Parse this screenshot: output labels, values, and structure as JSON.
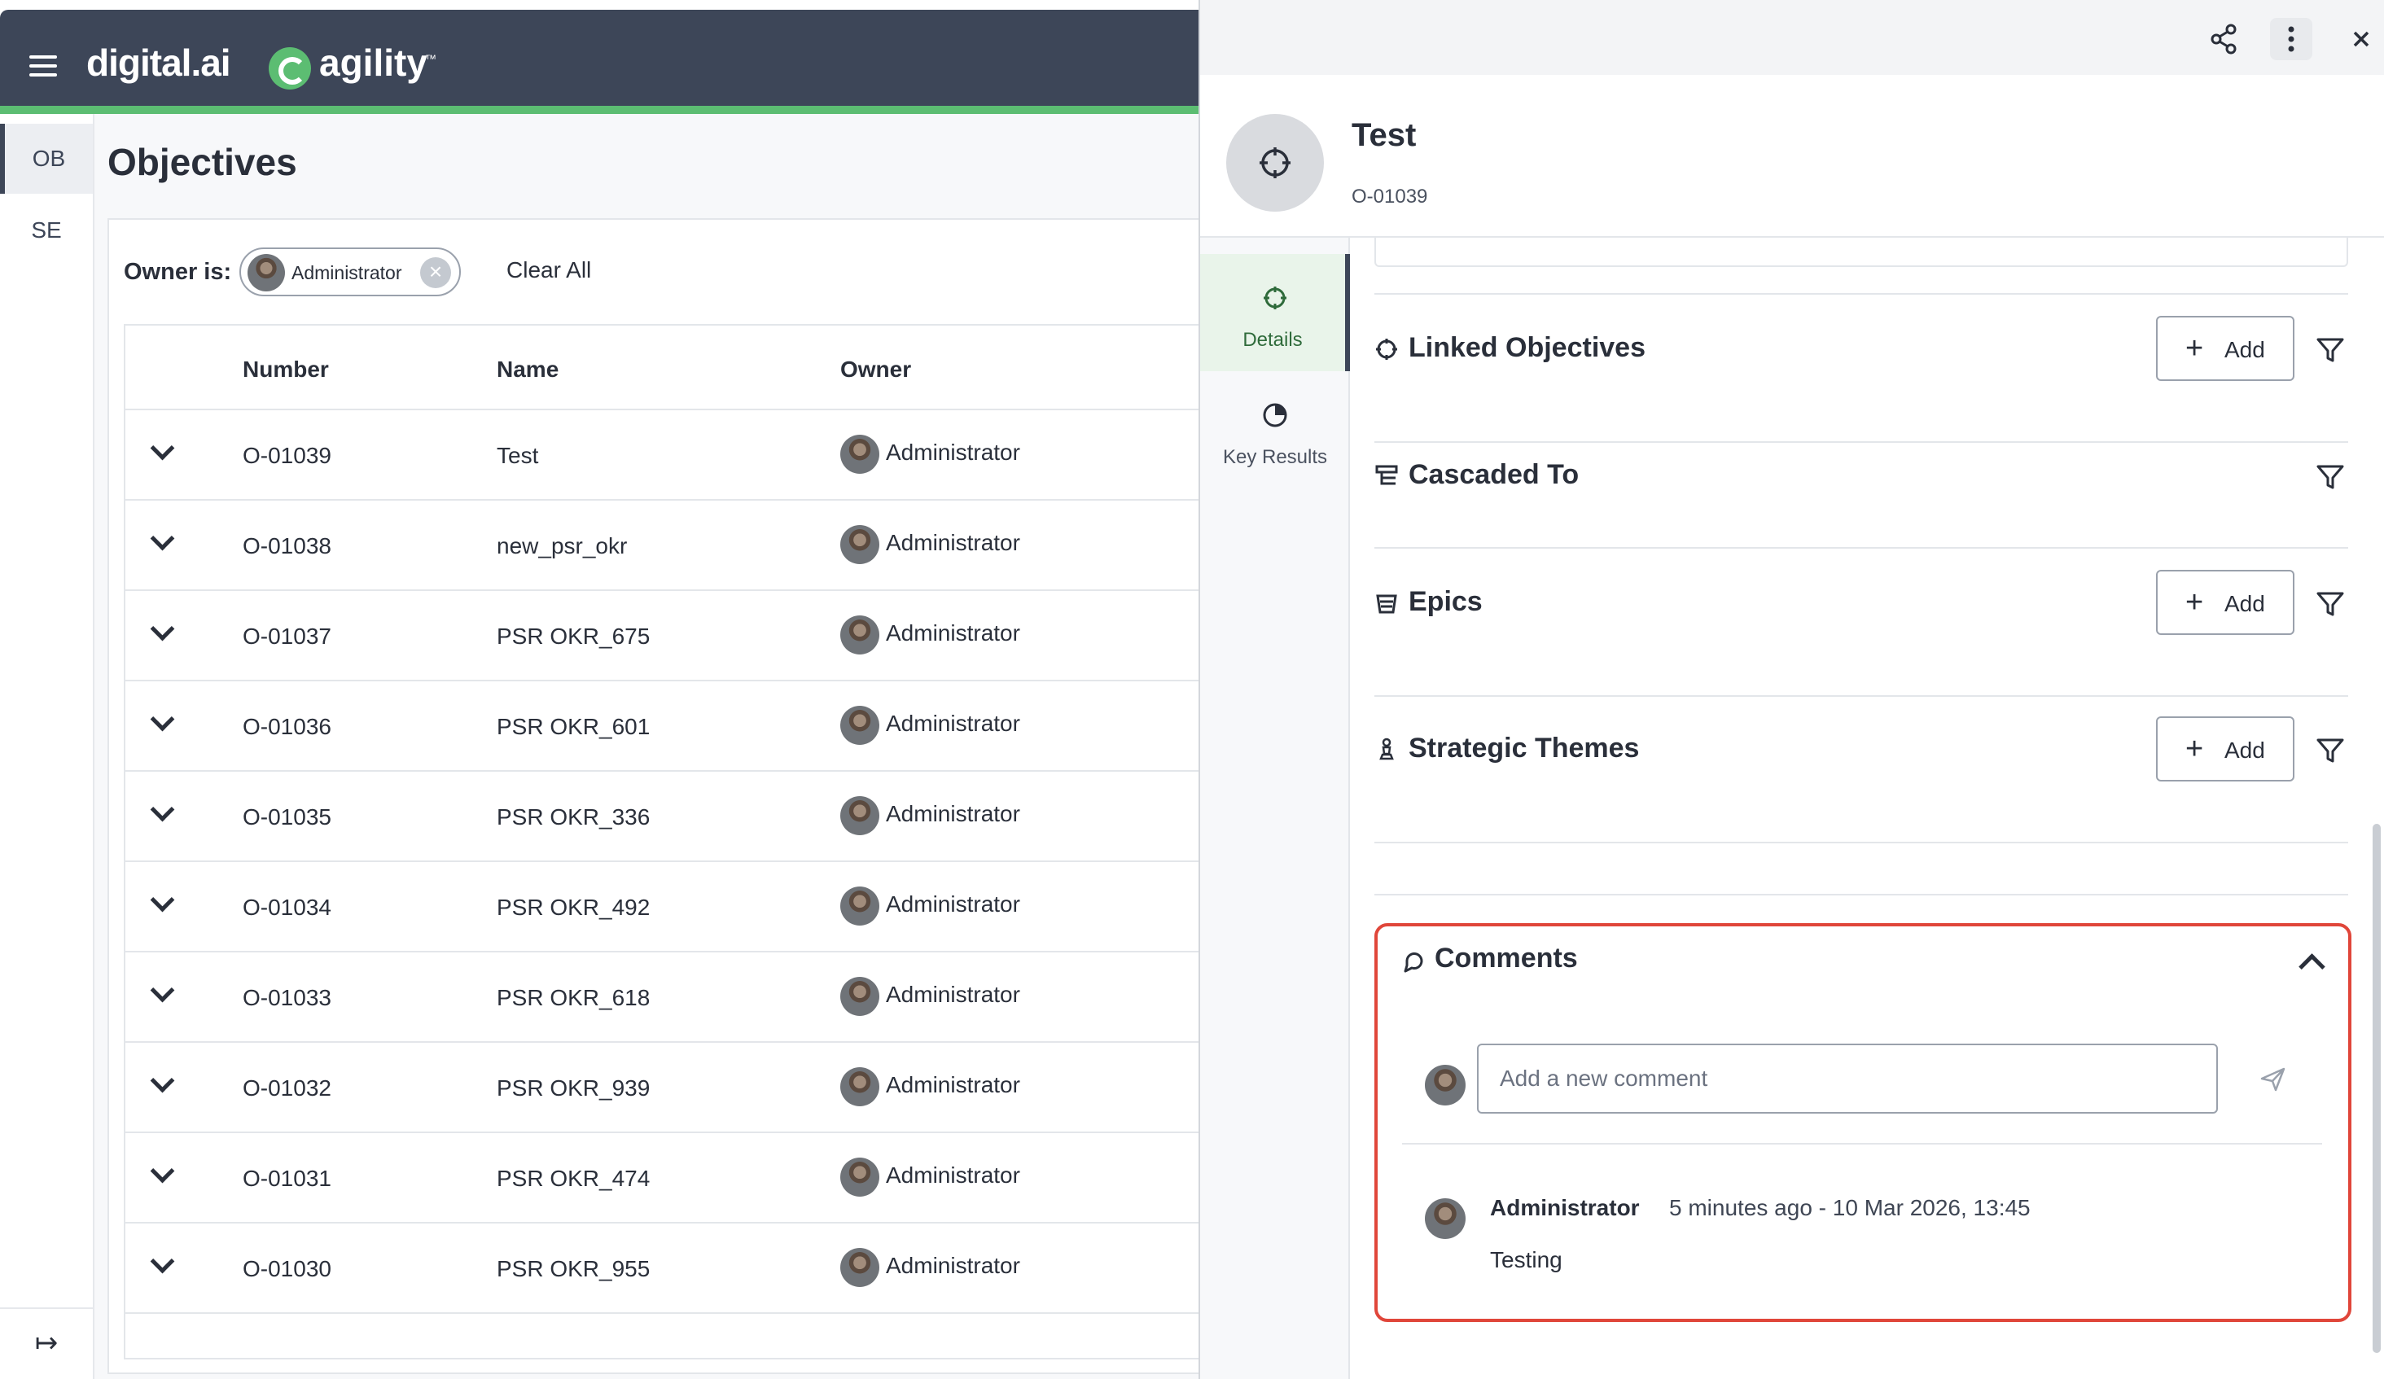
{
  "app": {
    "brand_left": "digital.ai",
    "brand_right": "agility",
    "brand_tm": "™",
    "accent": "#5cbd72",
    "header_bg": "#3d4658"
  },
  "rail": {
    "items": [
      {
        "label": "OB",
        "active": true
      },
      {
        "label": "SE",
        "active": false
      }
    ],
    "collapse_icon": "expand-panel-icon",
    "collapse_glyph": "↦"
  },
  "main": {
    "title": "Objectives",
    "filter": {
      "label": "Owner is:",
      "chip_value": "Administrator",
      "chip_remove": "×",
      "clear_all": "Clear All"
    },
    "table": {
      "columns": [
        "Number",
        "Name",
        "Owner"
      ],
      "rows": [
        {
          "number": "O-01039",
          "name": "Test",
          "owner": "Administrator"
        },
        {
          "number": "O-01038",
          "name": "new_psr_okr",
          "owner": "Administrator"
        },
        {
          "number": "O-01037",
          "name": "PSR OKR_675",
          "owner": "Administrator"
        },
        {
          "number": "O-01036",
          "name": "PSR OKR_601",
          "owner": "Administrator"
        },
        {
          "number": "O-01035",
          "name": "PSR OKR_336",
          "owner": "Administrator"
        },
        {
          "number": "O-01034",
          "name": "PSR OKR_492",
          "owner": "Administrator"
        },
        {
          "number": "O-01033",
          "name": "PSR OKR_618",
          "owner": "Administrator"
        },
        {
          "number": "O-01032",
          "name": "PSR OKR_939",
          "owner": "Administrator"
        },
        {
          "number": "O-01031",
          "name": "PSR OKR_474",
          "owner": "Administrator"
        },
        {
          "number": "O-01030",
          "name": "PSR OKR_955",
          "owner": "Administrator"
        }
      ]
    }
  },
  "panel": {
    "toolbar_icons": [
      "share-icon",
      "more-vertical-icon",
      "close-icon"
    ],
    "title": "Test",
    "id": "O-01039",
    "tabs": [
      {
        "label": "Details",
        "icon": "crosshair-icon",
        "active": true
      },
      {
        "label": "Key Results",
        "icon": "pie-chart-icon",
        "active": false
      }
    ],
    "sections": {
      "linked_objectives": {
        "title": "Linked Objectives",
        "add": "Add"
      },
      "cascaded_to": {
        "title": "Cascaded To"
      },
      "epics": {
        "title": "Epics",
        "add": "Add"
      },
      "strategic_themes": {
        "title": "Strategic Themes",
        "add": "Add"
      }
    },
    "comments": {
      "title": "Comments",
      "input_placeholder": "Add a new comment",
      "input_value": "",
      "highlight_color": "#e0463a",
      "items": [
        {
          "author": "Administrator",
          "time": "5 minutes ago - 10 Mar 2026, 13:45",
          "text": "Testing"
        }
      ]
    }
  }
}
